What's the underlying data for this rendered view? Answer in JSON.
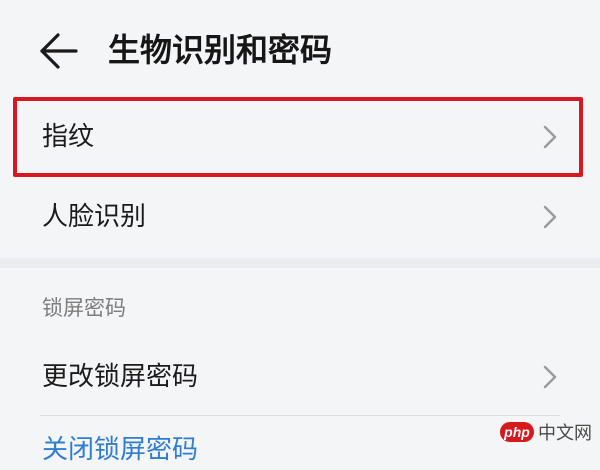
{
  "header": {
    "title": "生物识别和密码",
    "back_icon": "back-arrow-icon"
  },
  "biometrics": {
    "items": [
      {
        "label": "指纹",
        "icon": "chevron-right-icon",
        "highlighted": true
      },
      {
        "label": "人脸识别",
        "icon": "chevron-right-icon",
        "highlighted": false
      }
    ]
  },
  "lock_screen": {
    "section_title": "锁屏密码",
    "items": [
      {
        "label": "更改锁屏密码",
        "icon": "chevron-right-icon"
      },
      {
        "label": "关闭锁屏密码",
        "color": "#2f7dd1"
      }
    ]
  },
  "highlight": {
    "color": "#d81821"
  },
  "watermark": {
    "badge": "php",
    "text": "中文网",
    "badge_color": "#d5191d"
  }
}
